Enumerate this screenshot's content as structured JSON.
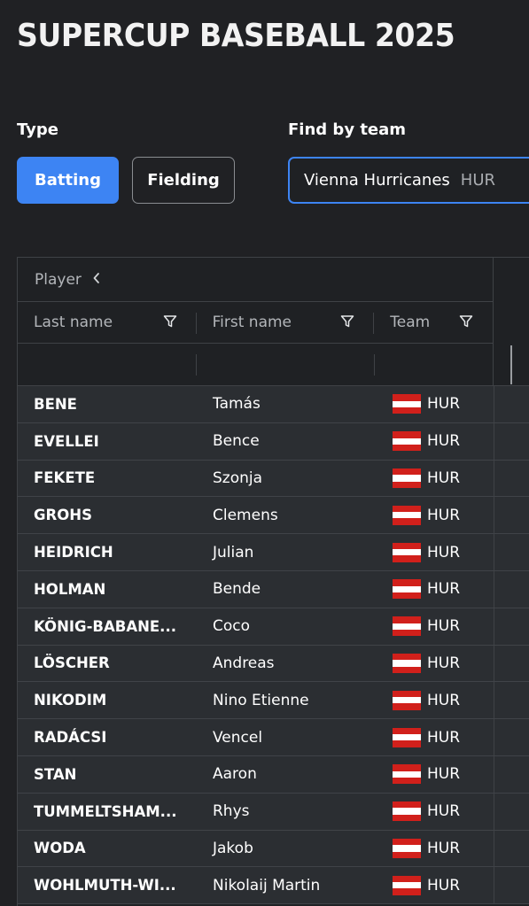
{
  "page": {
    "title": "SUPERCUP BASEBALL 2025"
  },
  "type_section": {
    "label": "Type",
    "buttons": [
      "Batting",
      "Fielding"
    ],
    "selected": "Batting"
  },
  "team_section": {
    "label": "Find by team",
    "team_name": "Vienna Hurricanes",
    "team_code": "HUR"
  },
  "colors": {
    "accent": "#3d84f3",
    "flag_red": "#d1201b",
    "flag_white": "#ffffff"
  },
  "grid": {
    "group_header": "Player",
    "columns": [
      "Last name",
      "First name",
      "Team"
    ],
    "rows": [
      {
        "last": "BENE",
        "first": "Tamás",
        "team": "HUR"
      },
      {
        "last": "EVELLEI",
        "first": "Bence",
        "team": "HUR"
      },
      {
        "last": "FEKETE",
        "first": "Szonja",
        "team": "HUR"
      },
      {
        "last": "GROHS",
        "first": "Clemens",
        "team": "HUR"
      },
      {
        "last": "HEIDRICH",
        "first": "Julian",
        "team": "HUR"
      },
      {
        "last": "HOLMAN",
        "first": "Bende",
        "team": "HUR"
      },
      {
        "last": "KÖNIG-BABANE...",
        "first": "Coco",
        "team": "HUR"
      },
      {
        "last": "LÖSCHER",
        "first": "Andreas",
        "team": "HUR"
      },
      {
        "last": "NIKODIM",
        "first": "Nino Etienne",
        "team": "HUR"
      },
      {
        "last": "RADÁCSI",
        "first": "Vencel",
        "team": "HUR"
      },
      {
        "last": "STAN",
        "first": "Aaron",
        "team": "HUR"
      },
      {
        "last": "TUMMELTSHAM...",
        "first": "Rhys",
        "team": "HUR"
      },
      {
        "last": "WODA",
        "first": "Jakob",
        "team": "HUR"
      },
      {
        "last": "WOHLMUTH-WI...",
        "first": "Nikolaij Martin",
        "team": "HUR"
      }
    ]
  }
}
